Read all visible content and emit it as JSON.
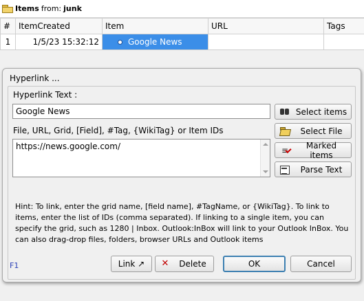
{
  "header": {
    "prefix": "Items",
    "from_label": "from:",
    "source": "junk"
  },
  "grid": {
    "columns": [
      "#",
      "ItemCreated",
      "Item",
      "URL",
      "Tags"
    ],
    "row": {
      "num": "1",
      "created": "1/5/23 15:32:12",
      "item": "Google News",
      "url": "",
      "tags": ""
    }
  },
  "dialog": {
    "title": "Hyperlink ...",
    "hyperlink_text_label": "Hyperlink Text :",
    "hyperlink_text_value": "Google News",
    "target_label": "File, URL, Grid, [Field], #Tag, {WikiTag} or Item IDs",
    "target_value": "https://news.google.com/",
    "buttons": {
      "select_items": "Select items",
      "select_file": "Select File",
      "marked_items": "Marked items",
      "parse_text": "Parse Text",
      "link": "Link",
      "delete": "Delete",
      "ok": "OK",
      "cancel": "Cancel"
    },
    "hint": "Hint: To link, enter the grid name, [field name], #TagName, or {WikiTag}. To link to items, enter the list of IDs (comma separated). If linking to a single item, you can specify the grid, such as 1280 | Inbox. Outlook:InBox will link to your Outlook InBox. You can also drag-drop files, folders, browser URLs and Outlook items",
    "f1": "F1"
  },
  "icons": {
    "folder": "folder-icon",
    "binoculars": "binoculars-icon",
    "open_folder": "open-folder-icon",
    "checklist": "checklist-icon",
    "parse": "parse-text-icon",
    "delete": "delete-x-icon",
    "link_arrow": "arrow-up-right-icon"
  },
  "colors": {
    "selection": "#3b8ee8",
    "default_button_border": "#3c7fb1",
    "delete_icon": "#c00000",
    "f1_link": "#2a3fb5"
  }
}
